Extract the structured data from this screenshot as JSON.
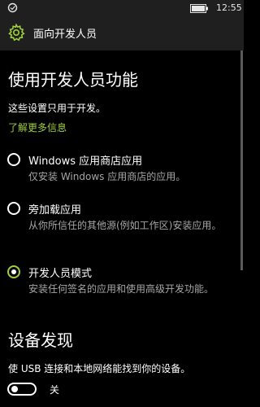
{
  "status_bar": {
    "time": "12:55",
    "icons": [
      "device-icon",
      "battery-icon"
    ]
  },
  "header": {
    "icon": "gear-icon",
    "title": "面向开发人员",
    "accent_color": "#9fcf3c"
  },
  "developer_features": {
    "title": "使用开发人员功能",
    "description": "这些设置只用于开发。",
    "learn_more_link": "了解更多信息",
    "options": [
      {
        "label": "Windows 应用商店应用",
        "description": "仅安装 Windows 应用商店的应用。",
        "selected": false
      },
      {
        "label": "旁加载应用",
        "description": "从你所信任的其他源(例如工作区)安装应用。",
        "selected": false
      },
      {
        "label": "开发人员模式",
        "description": "安装任何签名的应用和使用高级开发功能。",
        "selected": true
      }
    ]
  },
  "device_discovery": {
    "title": "设备发现",
    "description": "使 USB 连接和本地网络能找到你的设备。",
    "toggle": {
      "state_label": "关",
      "on": false
    }
  }
}
